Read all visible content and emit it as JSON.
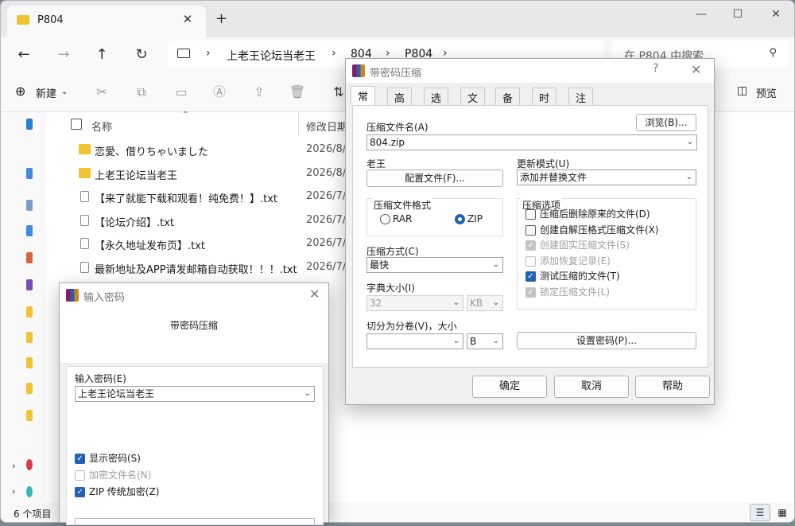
{
  "explorer": {
    "tab_title": "P804",
    "breadcrumbs": [
      "上老王论坛当老王",
      "804",
      "P804"
    ],
    "search_placeholder": "在 P804 中搜索",
    "new_label": "新建",
    "preview_label": "预览",
    "columns": {
      "name": "名称",
      "modified": "修改日期"
    },
    "files": [
      {
        "name": "恋愛、借りちゃいました",
        "date": "2026/8/",
        "type": "folder"
      },
      {
        "name": "上老王论坛当老王",
        "date": "2026/8/",
        "type": "folder"
      },
      {
        "name": "【来了就能下载和观看！纯免费！】.txt",
        "date": "2026/7/",
        "type": "txt"
      },
      {
        "name": "【论坛介绍】.txt",
        "date": "2026/7/",
        "type": "txt"
      },
      {
        "name": "【永久地址发布页】.txt",
        "date": "2026/7/",
        "type": "txt"
      },
      {
        "name": "最新地址及APP请发邮箱自动获取！！！.txt",
        "date": "2026/7/",
        "type": "txt"
      }
    ],
    "item_count": "6 个项目"
  },
  "compress_dialog": {
    "title": "带密码压缩",
    "help": "?",
    "tabs": [
      "常规",
      "高级",
      "选项",
      "文件",
      "备份",
      "时间",
      "注释"
    ],
    "archive_name_label": "压缩文件名(A)",
    "browse_label": "浏览(B)...",
    "archive_name": "804.zip",
    "profile_section": "老王",
    "profile_button": "配置文件(F)...",
    "update_mode_label": "更新模式(U)",
    "update_mode": "添加并替换文件",
    "format_label": "压缩文件格式",
    "format_rar": "RAR",
    "format_zip": "ZIP",
    "options_label": "压缩选项",
    "options": [
      {
        "label": "压缩后删除原来的文件(D)",
        "checked": false,
        "disabled": false
      },
      {
        "label": "创建自解压格式压缩文件(X)",
        "checked": false,
        "disabled": false
      },
      {
        "label": "创建固实压缩文件(S)",
        "checked": true,
        "disabled": true
      },
      {
        "label": "添加恢复记录(E)",
        "checked": false,
        "disabled": true
      },
      {
        "label": "测试压缩的文件(T)",
        "checked": true,
        "disabled": false
      },
      {
        "label": "锁定压缩文件(L)",
        "checked": true,
        "disabled": true
      }
    ],
    "method_label": "压缩方式(C)",
    "method": "最快",
    "dict_label": "字典大小(I)",
    "dict_value": "32",
    "dict_unit": "KB",
    "split_label": "切分为分卷(V)，大小",
    "split_value": "",
    "split_unit": "B",
    "set_password": "设置密码(P)...",
    "ok": "确定",
    "cancel": "取消",
    "help_button": "帮助"
  },
  "password_dialog": {
    "title": "输入密码",
    "header": "带密码压缩",
    "enter_label": "输入密码(E)",
    "password_value": "上老王论坛当老王",
    "show_password": "显示密码(S)",
    "encrypt_names": "加密文件名(N)",
    "zip_legacy": "ZIP 传统加密(Z)"
  }
}
